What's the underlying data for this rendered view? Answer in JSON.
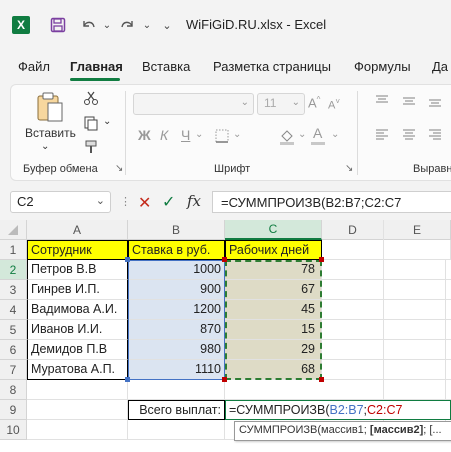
{
  "window": {
    "logo": "X",
    "filename": "WiFiGiD.RU.xlsx",
    "separator": "-",
    "app": "Excel"
  },
  "menu": {
    "items": [
      "Файл",
      "Главная",
      "Вставка",
      "Разметка страницы",
      "Формулы",
      "Да"
    ],
    "active": "Главная"
  },
  "ribbon": {
    "paste_label": "Вставить",
    "clipboard_group": "Буфер обмена",
    "font_group": "Шрифт",
    "align_group": "Выравн",
    "font_size": "11",
    "bold": "Ж",
    "italic": "К",
    "underline": "Ч"
  },
  "formula_bar": {
    "name_box": "C2",
    "fx": "fx",
    "formula": "=СУММПРОИЗВ(B2:B7;C2:C7"
  },
  "columns": [
    "A",
    "B",
    "C",
    "D",
    "E"
  ],
  "rows": [
    "1",
    "2",
    "3",
    "4",
    "5",
    "6",
    "7",
    "8",
    "9",
    "10"
  ],
  "table": {
    "headers": [
      "Сотрудник",
      "Ставка в руб.",
      "Рабочих дней"
    ],
    "data": [
      [
        "Петров В.В",
        "1000",
        "78"
      ],
      [
        "Гинрев И.П.",
        "900",
        "67"
      ],
      [
        "Вадимова А.И.",
        "1200",
        "45"
      ],
      [
        "Иванов И.И.",
        "870",
        "15"
      ],
      [
        "Демидов П.В",
        "980",
        "29"
      ],
      [
        "Муратова А.П.",
        "1110",
        "68"
      ]
    ]
  },
  "total": {
    "label": "Всего выплат:",
    "formula_prefix": "=СУММПРОИЗВ(",
    "range1": "B2:B7",
    "sep": ";",
    "range2": "C2:C7"
  },
  "tooltip": {
    "fn": "СУММПРОИЗВ(",
    "arg1": "массив1; ",
    "arg2": "[массив2]",
    "rest": "; [..."
  },
  "colors": {
    "header_fill": "#ffff00",
    "range_b_fill": "#dbe4f1",
    "range_b_border": "#4472c4",
    "range_c_fill": "#dedbc6",
    "range_c_border": "#2e7d32",
    "range_c_handle": "#c00000",
    "excel_green": "#107c41"
  }
}
